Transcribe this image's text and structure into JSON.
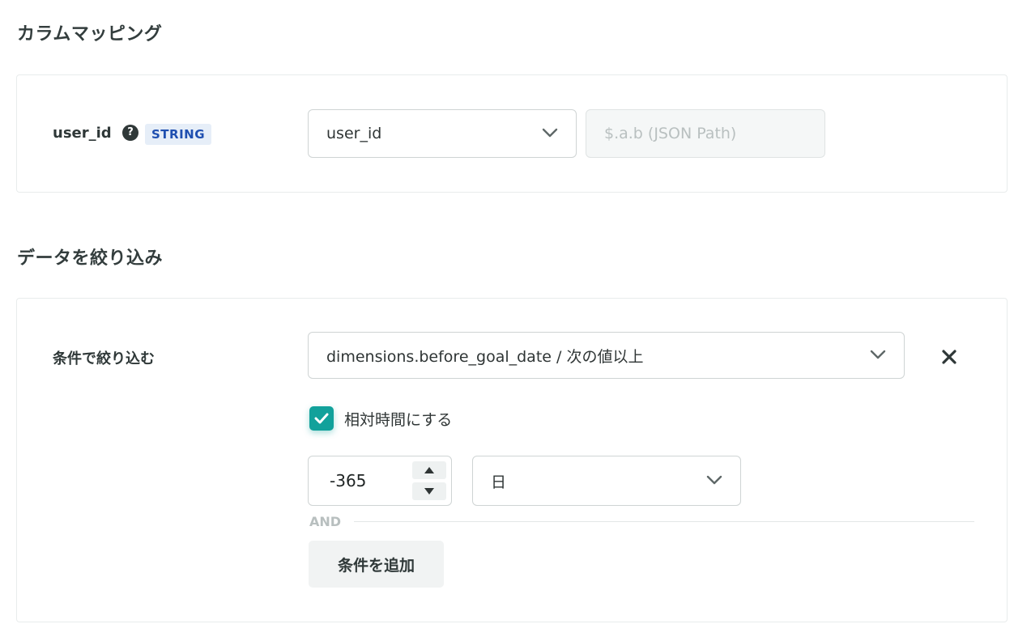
{
  "column_mapping": {
    "title": "カラムマッピング",
    "field": {
      "name": "user_id",
      "help_icon": "question-circle-icon",
      "type_badge": "STRING",
      "selected_column": "user_id",
      "json_path_placeholder": "$.a.b (JSON Path)"
    }
  },
  "filter": {
    "title": "データを絞り込み",
    "label": "条件で絞り込む",
    "condition_value": "dimensions.before_goal_date / 次の値以上",
    "relative_time": {
      "label": "相対時間にする",
      "checked": true
    },
    "amount": "-365",
    "unit": "日",
    "and_label": "AND",
    "add_condition_label": "条件を追加"
  },
  "colors": {
    "accent": "#12a19b",
    "badge_bg": "#e6eef8",
    "badge_text": "#1f4fb0"
  }
}
